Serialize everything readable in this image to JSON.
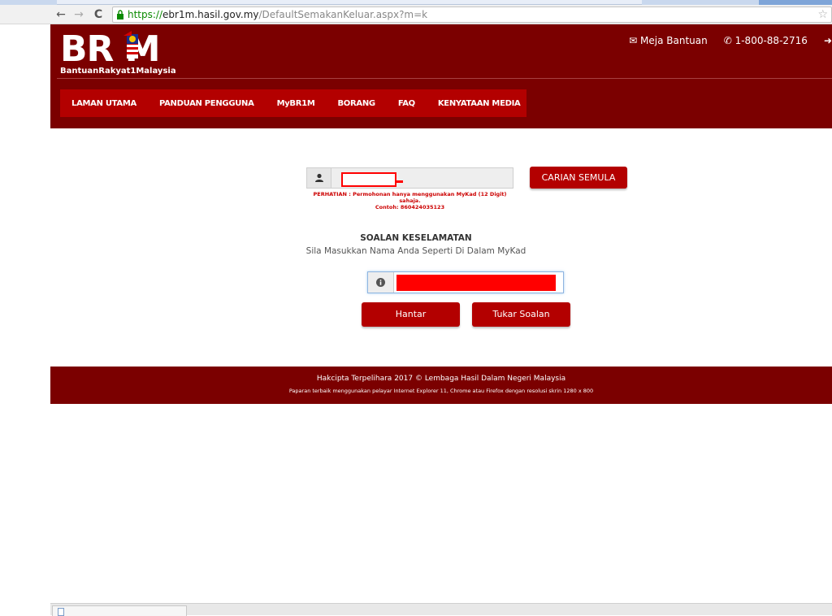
{
  "browser": {
    "url_scheme": "https://",
    "url_host": "ebr1m.hasil.gov.my",
    "url_path": "/DefaultSemakanKeluar.aspx?m=k"
  },
  "header": {
    "logo_text": "BR M",
    "logo_sub": "BantuanRakyat1Malaysia",
    "help_desk_label": "Meja Bantuan",
    "phone": "1-800-88-2716",
    "colors": {
      "header_bg": "#7b0000",
      "nav_bg": "#b30000"
    }
  },
  "nav": {
    "items": [
      "LAMAN UTAMA",
      "PANDUAN PENGGUNA",
      "MyBR1M",
      "BORANG",
      "FAQ",
      "KENYATAAN MEDIA"
    ]
  },
  "search": {
    "warning_line1": "PERHATIAN : Permohonan hanya menggunakan MyKad (12 Digit) sahaja.",
    "warning_line2": "Contoh: 860424035123",
    "button_label": "CARIAN SEMULA"
  },
  "security": {
    "title": "SOALAN KESELAMATAN",
    "subtitle": "Sila Masukkan Nama Anda Seperti Di Dalam MyKad",
    "submit_label": "Hantar",
    "change_label": "Tukar Soalan"
  },
  "footer": {
    "copyright": "Hakcipta Terpelihara 2017 © Lembaga Hasil Dalam Negeri Malaysia",
    "note": "Paparan terbaik menggunakan pelayar Internet Explorer 11, Chrome atau Firefox dengan resolusi skrin 1280 x 800"
  }
}
